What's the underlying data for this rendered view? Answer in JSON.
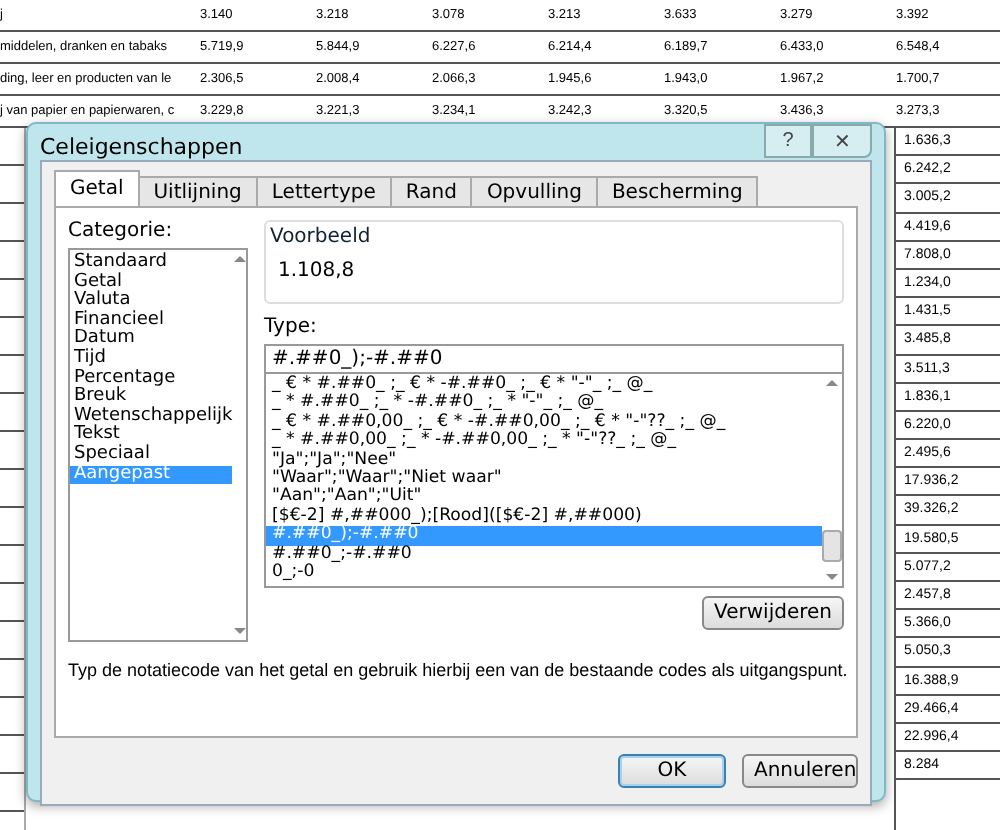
{
  "sheet": {
    "rows": [
      {
        "label": "j",
        "values": [
          "3.140",
          "3.218",
          "3.078",
          "3.213",
          "3.633",
          "3.279",
          "3.392"
        ]
      },
      {
        "label": "middelen, dranken en tabaks",
        "values": [
          "5.719,9",
          "5.844,9",
          "6.227,6",
          "6.214,4",
          "6.189,7",
          "6.433,0",
          "6.548,4"
        ]
      },
      {
        "label": "ding, leer en producten van le",
        "values": [
          "2.306,5",
          "2.008,4",
          "2.066,3",
          "1.945,6",
          "1.943,0",
          "1.967,2",
          "1.700,7"
        ]
      },
      {
        "label": "j van papier en papierwaren, c",
        "values": [
          "3.229,8",
          "3.221,3",
          "3.234,1",
          "3.242,3",
          "3.320,5",
          "3.436,3",
          "3.273,3"
        ]
      }
    ],
    "right_column": [
      "1.636,3",
      "6.242,2",
      "3.005,2",
      "4.419,6",
      "7.808,0",
      "1.234,0",
      "1.431,5",
      "3.485,8",
      "3.511,3",
      "1.836,1",
      "6.220,0",
      "2.495,6",
      "17.936,2",
      "39.326,2",
      "19.580,5",
      "5.077,2",
      "2.457,8",
      "5.366,0",
      "5.050,3",
      "16.388,9",
      "29.466,4",
      "22.996,4",
      "8.284"
    ]
  },
  "dialog": {
    "title": "Celeigenschappen",
    "help": "?",
    "close": "✕",
    "tabs": [
      {
        "label": "Getal",
        "selected": true
      },
      {
        "label": "Uitlijning",
        "selected": false
      },
      {
        "label": "Lettertype",
        "selected": false
      },
      {
        "label": "Rand",
        "selected": false
      },
      {
        "label": "Opvulling",
        "selected": false
      },
      {
        "label": "Bescherming",
        "selected": false
      }
    ],
    "category_label": "Categorie:",
    "categories": [
      {
        "label": "Standaard",
        "selected": false
      },
      {
        "label": "Getal",
        "selected": false
      },
      {
        "label": "Valuta",
        "selected": false
      },
      {
        "label": "Financieel",
        "selected": false
      },
      {
        "label": "Datum",
        "selected": false
      },
      {
        "label": "Tijd",
        "selected": false
      },
      {
        "label": "Percentage",
        "selected": false
      },
      {
        "label": "Breuk",
        "selected": false
      },
      {
        "label": "Wetenschappelijk",
        "selected": false
      },
      {
        "label": "Tekst",
        "selected": false
      },
      {
        "label": "Speciaal",
        "selected": false
      },
      {
        "label": "Aangepast",
        "selected": true
      }
    ],
    "sample_label": "Voorbeeld",
    "sample": "1.108,8",
    "type_label": "Type:",
    "type_value": "#.##0_);-#.##0",
    "formats": [
      {
        "label": "_ € * #.##0_ ;_ € * -#.##0_ ;_ € * \"-\"_ ;_ @_",
        "selected": false
      },
      {
        "label": "_ * #.##0_ ;_ * -#.##0_ ;_ * \"-\"_ ;_ @_",
        "selected": false
      },
      {
        "label": "_ € * #.##0,00_ ;_ € * -#.##0,00_ ;_ € * \"-\"??_ ;_ @_",
        "selected": false
      },
      {
        "label": "_ * #.##0,00_ ;_ * -#.##0,00_ ;_ * \"-\"??_ ;_ @_",
        "selected": false
      },
      {
        "label": "\"Ja\";\"Ja\";\"Nee\"",
        "selected": false
      },
      {
        "label": "\"Waar\";\"Waar\";\"Niet waar\"",
        "selected": false
      },
      {
        "label": "\"Aan\";\"Aan\";\"Uit\"",
        "selected": false
      },
      {
        "label": "[$€-2] #,##000_);[Rood]([$€-2] #,##000)",
        "selected": false
      },
      {
        "label": "#.##0_);-#.##0",
        "selected": true
      },
      {
        "label": "#.##0_;-#.##0",
        "selected": false
      },
      {
        "label": "0_;-0",
        "selected": false
      }
    ],
    "delete_button": "Verwijderen",
    "hint": "Typ de notatiecode van het getal en gebruik hierbij een van de bestaande codes als uitgangspunt.",
    "ok": "OK",
    "cancel": "Annuleren"
  }
}
